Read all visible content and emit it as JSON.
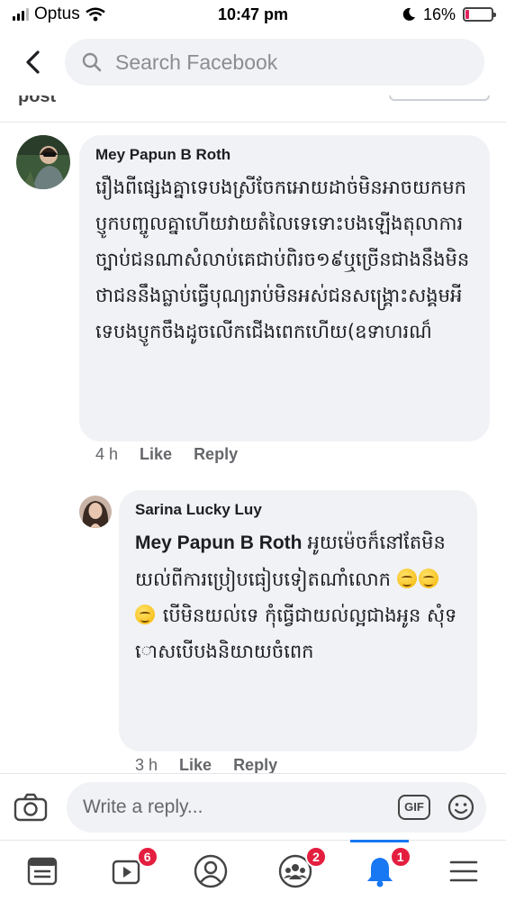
{
  "status_bar": {
    "carrier": "Optus",
    "time": "10:47 pm",
    "battery": "16%",
    "battery_level": 0.16
  },
  "header": {
    "search_placeholder": "Search Facebook"
  },
  "clipped_top_text": "post",
  "comments": [
    {
      "author": "Mey Papun B Roth",
      "text": "រឿងពីផ្សេងគ្នាទេបងស្រីចែកអោយដាច់មិនអាចយកមកប្ញូកបញ្ចូលគ្នាហើយវាយតំលៃទេទោះបងឡើងតុលាការច្បាប់ជនណាសំលាប់គេជាប់ពិរច១៩ឬច្រើនជាងនឹងមិនថាជននឹងធ្លាប់ធ្វើបុណ្យរាប់មិនអស់ជនសង្គ្រោះសង្គមអីទេបងប្ញូកចឹងដូចលើកជើងពេកហើយ(ឧទាហរណ៏",
      "time": "4 h",
      "like": "Like",
      "reply": "Reply"
    },
    {
      "author": "Sarina Lucky Luy",
      "mention": "Mey Papun B Roth",
      "text_1": "អូយម៉េចក៏នៅតែមិនយល់ពីការប្រៀបធៀបទៀតណាំលោក",
      "text_2": "បើមិនយល់ទេ កុំធ្វើជាយល់ល្អជាងអូន សុំទោសបើបងនិយាយចំពេក",
      "emojis": [
        "smirk-emoji",
        "smirk-emoji",
        "smirk-emoji"
      ],
      "time": "3 h",
      "like": "Like",
      "reply": "Reply"
    }
  ],
  "composer": {
    "placeholder": "Write a reply...",
    "gif_label": "GIF"
  },
  "bottom_nav": {
    "items": [
      {
        "icon": "news-feed-icon",
        "badge": ""
      },
      {
        "icon": "watch-icon",
        "badge": "6"
      },
      {
        "icon": "profile-icon",
        "badge": ""
      },
      {
        "icon": "groups-icon",
        "badge": "2"
      },
      {
        "icon": "notifications-icon",
        "badge": "1"
      },
      {
        "icon": "menu-icon",
        "badge": ""
      }
    ]
  },
  "colors": {
    "accent": "#1877f2",
    "badge": "#e41e3f",
    "bubble": "#f0f2f5"
  }
}
